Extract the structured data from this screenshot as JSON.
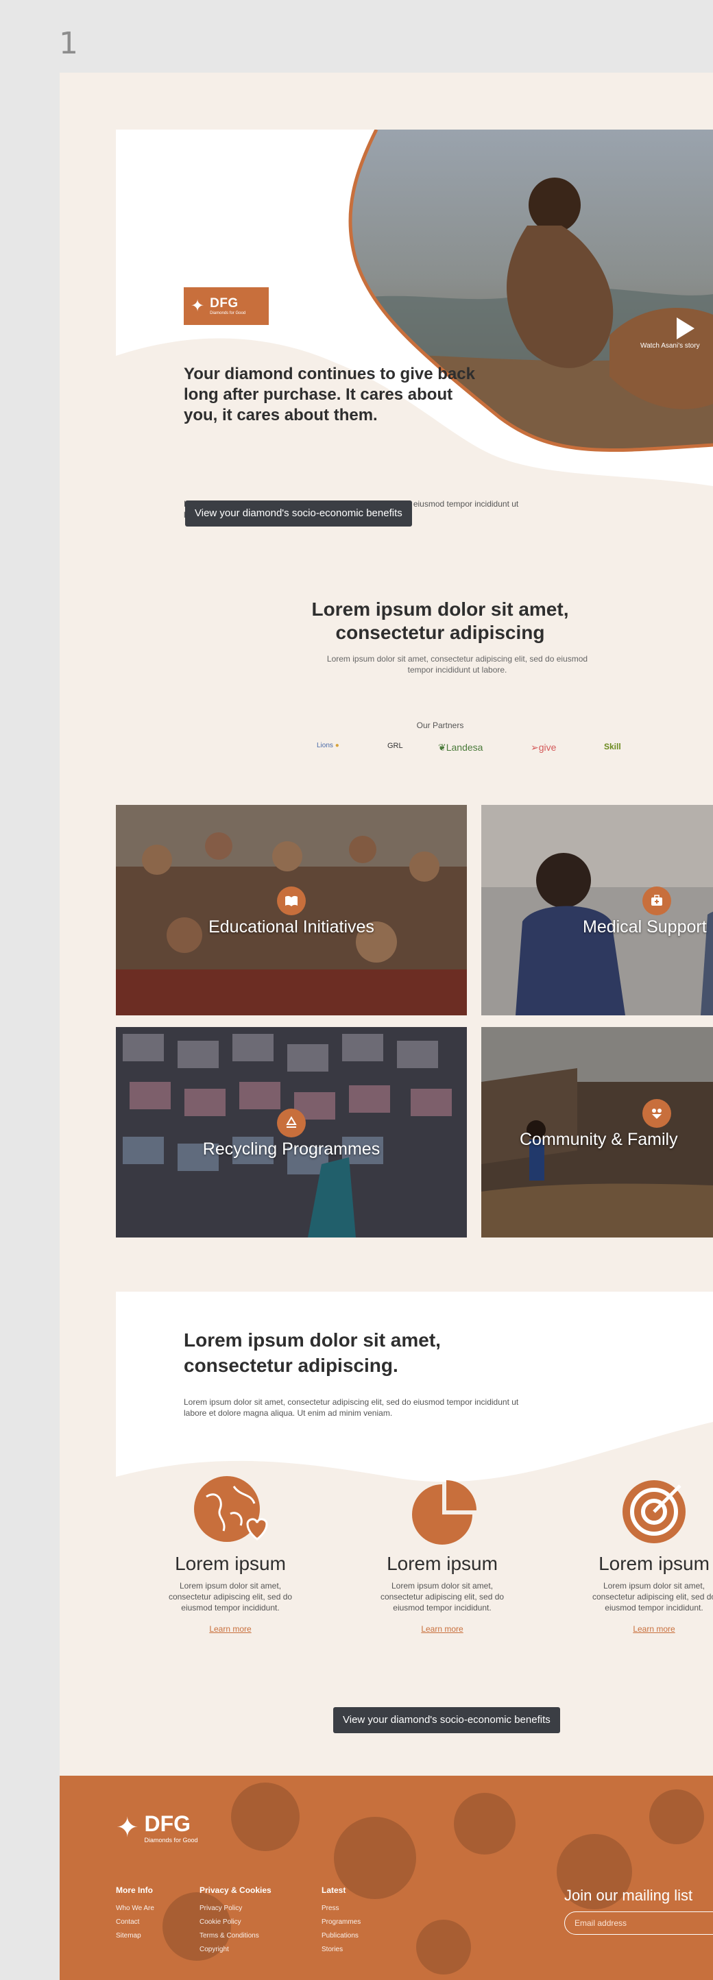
{
  "artboard": {
    "number": "1"
  },
  "hero": {
    "badge": {
      "brand": "DFG",
      "tagline": "Diamonds for Good"
    },
    "title": "Your diamond continues to give back long after purchase. It cares about you, it cares about them.",
    "text": "Lorem ipsum dolor sit amet, consectetur adipiscing elit, sed do eiusmod tempor incididunt ut labore et dolore magna aliqua. Ut enim ad minim veniam.",
    "button_label": "View your diamond's socio-economic benefits",
    "video_label": "Watch Asani's story",
    "icons": {
      "play": "play-icon",
      "diamond": "diamond-icon"
    }
  },
  "intro": {
    "title": "Lorem ipsum dolor sit amet, consectetur adipiscing",
    "text": "Lorem ipsum dolor sit amet, consectetur adipiscing elit, sed do eiusmod tempor incididunt ut labore.",
    "partners_label": "Our Partners",
    "partners": [
      "Lions",
      "GRL",
      "Landesa",
      "give",
      "Skill"
    ]
  },
  "tiles": [
    {
      "label": "Educational Initiatives",
      "icon": "book-icon"
    },
    {
      "label": "Medical Support",
      "icon": "medical-kit-icon"
    },
    {
      "label": "Recycling Programmes",
      "icon": "recycle-icon"
    },
    {
      "label": "Community & Family",
      "icon": "heart-community-icon"
    }
  ],
  "benefits": {
    "title": "Lorem ipsum dolor sit amet, consectetur adipiscing.",
    "text": "Lorem ipsum dolor sit amet, consectetur adipiscing elit, sed do eiusmod tempor incididunt ut labore et dolore magna aliqua. Ut enim ad minim veniam.",
    "features": [
      {
        "title": "Lorem ipsum",
        "text": "Lorem ipsum dolor sit amet, consectetur adipiscing elit, sed do eiusmod tempor incididunt.",
        "link": "Learn more",
        "icon": "globe-heart-icon"
      },
      {
        "title": "Lorem ipsum",
        "text": "Lorem ipsum dolor sit amet, consectetur adipiscing elit, sed do eiusmod tempor incididunt.",
        "link": "Learn more",
        "icon": "pie-chart-icon"
      },
      {
        "title": "Lorem ipsum",
        "text": "Lorem ipsum dolor sit amet, consectetur adipiscing elit, sed do eiusmod tempor incididunt.",
        "link": "Learn more",
        "icon": "target-icon"
      }
    ],
    "button_label": "View your diamond's socio-economic benefits"
  },
  "footer": {
    "brand": "DFG",
    "brand_tagline": "Diamonds for Good",
    "columns": [
      {
        "heading": "More Info",
        "items": [
          "Who We Are",
          "Contact",
          "Sitemap"
        ]
      },
      {
        "heading": "Privacy & Cookies",
        "items": [
          "Privacy Policy",
          "Cookie Policy",
          "Terms & Conditions",
          "Copyright"
        ]
      },
      {
        "heading": "Latest",
        "items": [
          "Press",
          "Programmes",
          "Publications",
          "Stories"
        ]
      }
    ],
    "mailing_title": "Join our mailing list",
    "email_placeholder": "Email address"
  },
  "colors": {
    "accent": "#c86f3c",
    "dark_button": "#3b3e44",
    "page_bg": "#f6efe8",
    "canvas_bg": "#e7e7e7"
  }
}
